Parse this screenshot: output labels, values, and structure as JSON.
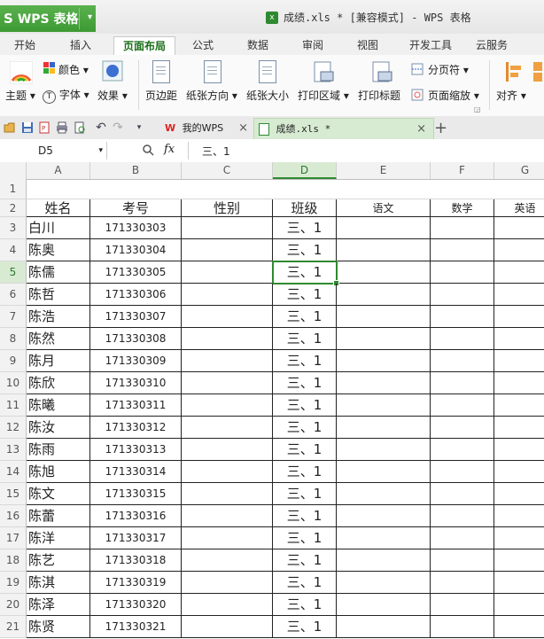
{
  "app": {
    "name": "WPS 表格",
    "menu_arrow": "▾"
  },
  "window": {
    "title": "成绩.xls * [兼容模式] - WPS 表格"
  },
  "ribbon_tabs": [
    "开始",
    "插入",
    "页面布局",
    "公式",
    "数据",
    "审阅",
    "视图",
    "开发工具",
    "云服务"
  ],
  "active_ribbon_tab": "页面布局",
  "ribbon": {
    "theme": "主题",
    "color": "颜色",
    "font": "字体",
    "effect": "效果",
    "margins": "页边距",
    "orientation": "纸张方向",
    "size": "纸张大小",
    "print_area": "打印区域",
    "print_titles": "打印标题",
    "page_break": "分页符",
    "page_zoom": "页面缩放",
    "align": "对齐"
  },
  "doc_tabs": [
    {
      "label": "我的WPS"
    },
    {
      "label": "成绩.xls *"
    }
  ],
  "formula_bar": {
    "name_box": "D5",
    "fx": "fx",
    "content": "三、1"
  },
  "columns": [
    "A",
    "B",
    "C",
    "D",
    "E",
    "F",
    "G"
  ],
  "selected_column": "D",
  "selected_row": 5,
  "headers_row": [
    "姓名",
    "考号",
    "性别",
    "班级",
    "语文",
    "数学",
    "英语"
  ],
  "rows": [
    {
      "n": 3,
      "name": "白川",
      "id": "171330303",
      "cls": "三、1"
    },
    {
      "n": 4,
      "name": "陈奥",
      "id": "171330304",
      "cls": "三、1"
    },
    {
      "n": 5,
      "name": "陈儒",
      "id": "171330305",
      "cls": "三、1"
    },
    {
      "n": 6,
      "name": "陈哲",
      "id": "171330306",
      "cls": "三、1"
    },
    {
      "n": 7,
      "name": "陈浩",
      "id": "171330307",
      "cls": "三、1"
    },
    {
      "n": 8,
      "name": "陈然",
      "id": "171330308",
      "cls": "三、1"
    },
    {
      "n": 9,
      "name": "陈月",
      "id": "171330309",
      "cls": "三、1"
    },
    {
      "n": 10,
      "name": "陈欣",
      "id": "171330310",
      "cls": "三、1"
    },
    {
      "n": 11,
      "name": "陈曦",
      "id": "171330311",
      "cls": "三、1"
    },
    {
      "n": 12,
      "name": "陈汝",
      "id": "171330312",
      "cls": "三、1"
    },
    {
      "n": 13,
      "name": "陈雨",
      "id": "171330313",
      "cls": "三、1"
    },
    {
      "n": 14,
      "name": "陈旭",
      "id": "171330314",
      "cls": "三、1"
    },
    {
      "n": 15,
      "name": "陈文",
      "id": "171330315",
      "cls": "三、1"
    },
    {
      "n": 16,
      "name": "陈蕾",
      "id": "171330316",
      "cls": "三、1"
    },
    {
      "n": 17,
      "name": "陈洋",
      "id": "171330317",
      "cls": "三、1"
    },
    {
      "n": 18,
      "name": "陈艺",
      "id": "171330318",
      "cls": "三、1"
    },
    {
      "n": 19,
      "name": "陈淇",
      "id": "171330319",
      "cls": "三、1"
    },
    {
      "n": 20,
      "name": "陈泽",
      "id": "171330320",
      "cls": "三、1"
    },
    {
      "n": 21,
      "name": "陈贤",
      "id": "171330321",
      "cls": "三、1"
    }
  ],
  "icons": [
    "theme-icon",
    "color-palette-icon",
    "font-icon",
    "effect-icon",
    "margins-icon",
    "orientation-icon",
    "paper-size-icon",
    "print-area-icon",
    "print-title-icon",
    "page-break-icon",
    "page-zoom-icon",
    "align-icon",
    "open-folder-icon",
    "save-icon",
    "pdf-icon",
    "print-icon",
    "print-preview-icon",
    "undo-icon",
    "redo-icon",
    "wps-logo-icon",
    "xls-file-icon",
    "close-icon",
    "plus-icon",
    "search-icon"
  ],
  "colors": {
    "accent": "#2f8a2f",
    "app_button": "#3d9a33"
  }
}
